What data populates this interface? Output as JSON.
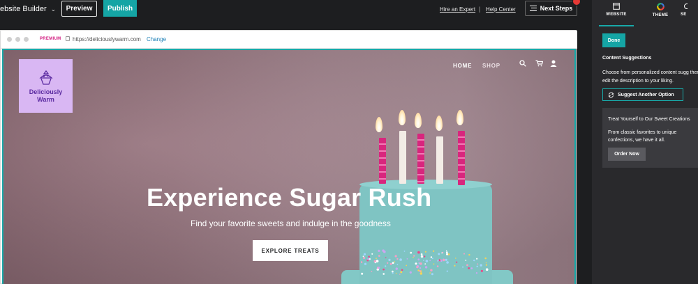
{
  "topbar": {
    "brand": "ebsite Builder",
    "preview_label": "Preview",
    "publish_label": "Publish",
    "hire_label": "Hire an Expert",
    "separator": "|",
    "help_label": "Help Center",
    "next_steps_label": "Next Steps"
  },
  "browser": {
    "premium_label": "PREMIUM",
    "url": "https://deliciouslywarm.com",
    "change_label": "Change"
  },
  "site": {
    "logo_line1": "Deliciously",
    "logo_line2": "Warm",
    "nav": [
      "HOME",
      "SHOP"
    ],
    "headline": "Experience Sugar Rush",
    "subline": "Find your favorite sweets and indulge in the goodness",
    "cta_label": "EXPLORE TREATS"
  },
  "panel": {
    "tabs": [
      {
        "label": "WEBSITE",
        "icon": "browser-window-icon"
      },
      {
        "label": "THEME",
        "icon": "color-wheel-icon"
      },
      {
        "label": "SE",
        "icon": "settings-icon"
      }
    ],
    "done_label": "Done",
    "content_title": "Content Suggestions",
    "content_desc": "Choose from personalized content sugg then edit the description to your liking.",
    "suggest_label": "Suggest Another Option",
    "card_title": "Treat Yourself to Our Sweet Creations",
    "card_body": "From classic favorites to unique confections, we have it all.",
    "order_label": "Order Now"
  },
  "colors": {
    "accent": "#15a5a5",
    "premium": "#d21a7f",
    "logo_bg": "#d9b7f3",
    "topbar_bg": "#1d1e20",
    "panel_bg": "#29292c"
  }
}
